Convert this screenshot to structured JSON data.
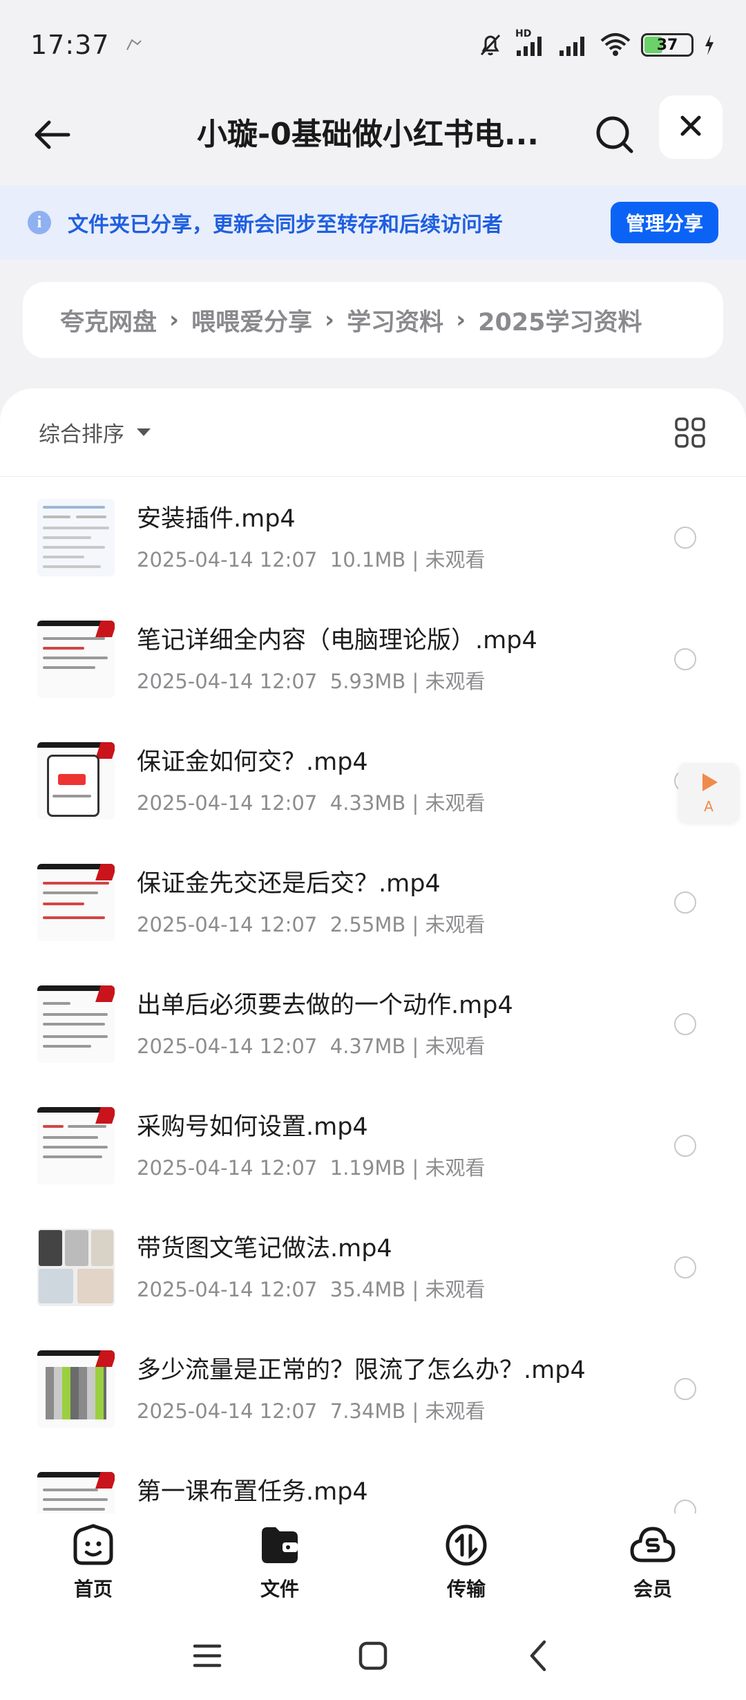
{
  "status_bar": {
    "time": "17:37",
    "extra_icon": "pin-icon",
    "network_label": "HD",
    "battery_level": "37"
  },
  "nav": {
    "title": "小璇-0基础做小红书电...",
    "back_icon": "arrow-left-icon",
    "search_icon": "search-icon",
    "close_icon": "close-icon"
  },
  "share_banner": {
    "text": "文件夹已分享，更新会同步至转存和后续访问者",
    "button": "管理分享"
  },
  "breadcrumb": {
    "items": [
      "夸克网盘",
      "喂喂爱分享",
      "学习资料",
      "2025学习资料"
    ],
    "separator": "›"
  },
  "sort": {
    "label": "综合排序",
    "grid_icon": "grid-icon"
  },
  "files": [
    {
      "name": "安装插件.mp4",
      "date": "2025-04-14 12:07",
      "size": "10.1MB",
      "status": "未观看"
    },
    {
      "name": "笔记详细全内容（电脑理论版）.mp4",
      "date": "2025-04-14 12:07",
      "size": "5.93MB",
      "status": "未观看"
    },
    {
      "name": "保证金如何交？.mp4",
      "date": "2025-04-14 12:07",
      "size": "4.33MB",
      "status": "未观看"
    },
    {
      "name": "保证金先交还是后交？.mp4",
      "date": "2025-04-14 12:07",
      "size": "2.55MB",
      "status": "未观看"
    },
    {
      "name": "出单后必须要去做的一个动作.mp4",
      "date": "2025-04-14 12:07",
      "size": "4.37MB",
      "status": "未观看"
    },
    {
      "name": "采购号如何设置.mp4",
      "date": "2025-04-14 12:07",
      "size": "1.19MB",
      "status": "未观看"
    },
    {
      "name": "带货图文笔记做法.mp4",
      "date": "2025-04-14 12:07",
      "size": "35.4MB",
      "status": "未观看"
    },
    {
      "name": "多少流量是正常的？限流了怎么办？.mp4",
      "date": "2025-04-14 12:07",
      "size": "7.34MB",
      "status": "未观看"
    },
    {
      "name": "第一课布置任务.mp4",
      "date": "",
      "size": "",
      "status": ""
    }
  ],
  "meta_separator": "|",
  "float_player": {
    "icon": "play-icon",
    "letter": "A"
  },
  "tabs": [
    {
      "label": "首页",
      "icon": "home-smile-icon"
    },
    {
      "label": "文件",
      "icon": "folder-icon"
    },
    {
      "label": "传输",
      "icon": "transfer-icon"
    },
    {
      "label": "会员",
      "icon": "vip-cloud-icon"
    }
  ],
  "system_nav": {
    "menu_icon": "menu-icon",
    "home_icon": "home-square-icon",
    "back_icon": "back-icon"
  },
  "colors": {
    "accent": "#0b63f6",
    "banner_bg": "#e8eefb",
    "banner_text": "#1f5fe0",
    "play_orange": "#f08a4b"
  }
}
